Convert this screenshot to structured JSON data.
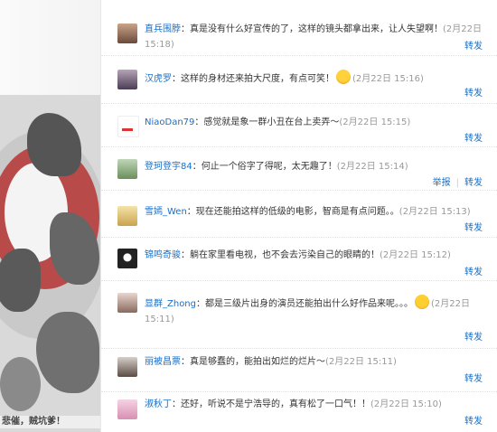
{
  "poster": {
    "caption": "悲催，贼坑爹！"
  },
  "comments": [
    {
      "user": "直兵围脖",
      "text": "真是没有什么好宣传的了，这样的镜头都拿出来，让人失望啊！",
      "time": "(2月22日 15:18)",
      "actions": [
        "转发"
      ]
    },
    {
      "user": "汉虎罗",
      "text": "这样的身材还来拍大尺度，有点可笑！",
      "time": "(2月22日 15:16)",
      "actions": [
        "转发"
      ],
      "emoji": "grin-emoji"
    },
    {
      "user": "NiaoDan79",
      "text": "感觉就是象一群小丑在台上卖弄～",
      "time": "(2月22日 15:15)",
      "actions": [
        "转发"
      ]
    },
    {
      "user": "登珂登宇84",
      "text": "何止一个俗字了得呢，太无趣了！",
      "time": "(2月22日 15:14)",
      "actions": [
        "举报",
        "转发"
      ]
    },
    {
      "user": "雪嫣_Wen",
      "text": "现在还能拍这样的低级的电影，智商是有点问题。。",
      "time": "(2月22日 15:13)",
      "actions": [
        "转发"
      ]
    },
    {
      "user": "锦鸣奇骏",
      "text": "躺在家里看电视，也不会去污染自己的眼睛的！",
      "time": "(2月22日 15:12)",
      "actions": [
        "转发"
      ]
    },
    {
      "user": "显群_Zhong",
      "text": "都是三级片出身的演员还能拍出什么好作品来呢。。。",
      "time": "(2月22日 15:11)",
      "actions": [
        "转发"
      ],
      "emoji": "laugh-emoji"
    },
    {
      "user": "丽被昌票",
      "text": "真是够蠢的，能拍出如烂的烂片～",
      "time": "(2月22日 15:11)",
      "actions": [
        "转发"
      ]
    },
    {
      "user": "淑秋丁",
      "text": "还好，听说不是宁浩导的，真有松了一口气！！",
      "time": "(2月22日 15:10)",
      "actions": [
        "转发"
      ]
    }
  ]
}
